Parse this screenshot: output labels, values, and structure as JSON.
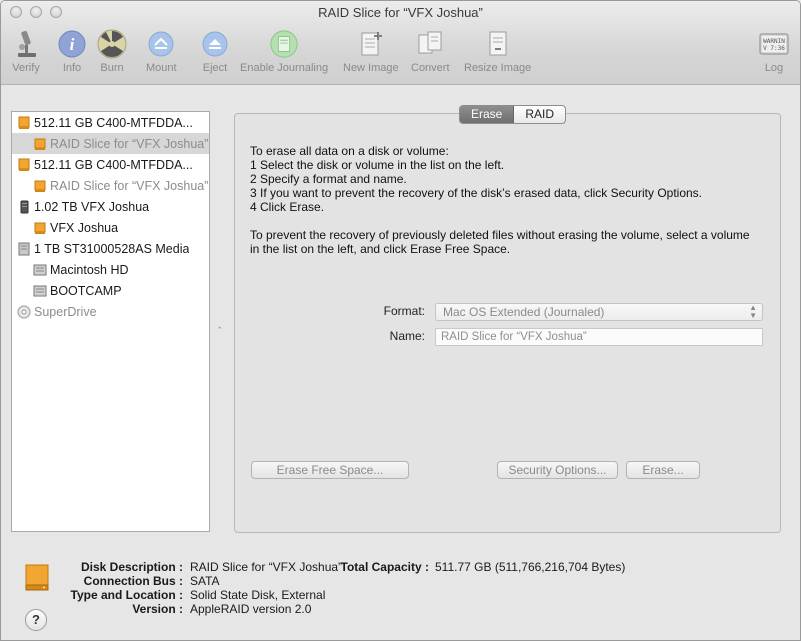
{
  "window": {
    "title": "RAID Slice for “VFX Joshua”"
  },
  "toolbar": {
    "verify": "Verify",
    "info": "Info",
    "burn": "Burn",
    "mount": "Mount",
    "eject": "Eject",
    "enable_journaling": "Enable Journaling",
    "new_image": "New Image",
    "convert": "Convert",
    "resize_image": "Resize Image",
    "log": "Log",
    "log_icon_text": "WARNIN\nV 7:36"
  },
  "sidebar": {
    "items": [
      {
        "label": "512.11 GB C400-MTFDDA...",
        "icon": "hard-drive-orange-icon",
        "level": 0,
        "selected": false,
        "dim": false
      },
      {
        "label": "RAID Slice for “VFX Joshua”",
        "icon": "volume-orange-icon",
        "level": 1,
        "selected": true,
        "dim": true
      },
      {
        "label": "512.11 GB C400-MTFDDA...",
        "icon": "hard-drive-orange-icon",
        "level": 0,
        "selected": false,
        "dim": false
      },
      {
        "label": "RAID Slice for “VFX Joshua”",
        "icon": "volume-orange-icon",
        "level": 1,
        "selected": false,
        "dim": true
      },
      {
        "label": "1.02 TB VFX Joshua",
        "icon": "raid-set-icon",
        "level": 0,
        "selected": false,
        "dim": false
      },
      {
        "label": "VFX Joshua",
        "icon": "volume-orange-icon",
        "level": 1,
        "selected": false,
        "dim": false
      },
      {
        "label": "1 TB ST31000528AS Media",
        "icon": "hard-drive-gray-icon",
        "level": 0,
        "selected": false,
        "dim": false
      },
      {
        "label": "Macintosh HD",
        "icon": "volume-gray-icon",
        "level": 1,
        "selected": false,
        "dim": false
      },
      {
        "label": "BOOTCAMP",
        "icon": "volume-gray-icon",
        "level": 1,
        "selected": false,
        "dim": false
      },
      {
        "label": "SuperDrive",
        "icon": "superdrive-icon",
        "level": 0,
        "selected": false,
        "dim": true
      }
    ]
  },
  "tabs": {
    "erase": "Erase",
    "raid": "RAID"
  },
  "erase_panel": {
    "instructions": [
      "To erase all data on a disk or volume:",
      "1 Select the disk or volume in the list on the left.",
      "2 Specify a format and name.",
      "3 If you want to prevent the recovery of the disk’s erased data, click Security Options.",
      "4 Click Erase."
    ],
    "free_space_text_1": "To prevent the recovery of previously deleted files without erasing the volume, select a volume",
    "free_space_text_2": "in the list on the left, and click Erase Free Space.",
    "format_label": "Format:",
    "format_value": "Mac OS Extended (Journaled)",
    "name_label": "Name:",
    "name_value": "RAID Slice for “VFX Joshua”",
    "erase_free_space_btn": "Erase Free Space...",
    "security_options_btn": "Security Options...",
    "erase_btn": "Erase..."
  },
  "info": {
    "disk_description_label": "Disk Description :",
    "disk_description": "RAID Slice for “VFX Joshua”",
    "total_capacity_label": "Total Capacity :",
    "total_capacity": "511.77 GB (511,766,216,704 Bytes)",
    "connection_bus_label": "Connection Bus :",
    "connection_bus": "SATA",
    "type_location_label": "Type and Location :",
    "type_location": "Solid State Disk, External",
    "version_label": "Version :",
    "version": "AppleRAID version 2.0",
    "help_label": "?"
  },
  "colors": {
    "accent_orange": "#f0a020",
    "selected_row": "#d7d7d7",
    "disabled_text": "#8a8a8a"
  }
}
